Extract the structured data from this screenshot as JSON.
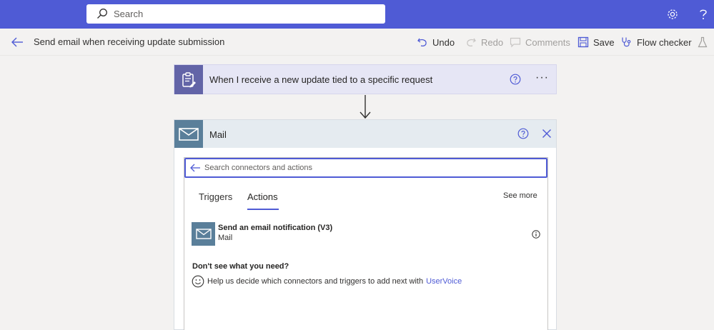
{
  "topbar": {
    "search_placeholder": "Search",
    "icons": [
      "search-icon",
      "settings-icon",
      "help-icon"
    ]
  },
  "commandbar": {
    "flow_title": "Send email when receiving update submission",
    "undo": "Undo",
    "redo": "Redo",
    "comments": "Comments",
    "save": "Save",
    "flow_checker": "Flow checker"
  },
  "trigger": {
    "title": "When I receive a new update tied to a specific request",
    "more": "···"
  },
  "mail_card": {
    "title": "Mail",
    "search_placeholder": "Search connectors and actions",
    "tabs": [
      {
        "label": "Triggers",
        "active": false
      },
      {
        "label": "Actions",
        "active": true
      }
    ],
    "see_more": "See more",
    "actions": [
      {
        "title": "Send an email notification (V3)",
        "subtitle": "Mail"
      }
    ],
    "dont_see": "Don't see what you need?",
    "help_text": "Help us decide which connectors and triggers to add next with",
    "help_link": "UserVoice"
  },
  "colors": {
    "topbar": "#4f5bd5",
    "trigger_icon": "#6264a7",
    "mail_icon": "#5a7f9a",
    "link": "#4f5bd5"
  }
}
